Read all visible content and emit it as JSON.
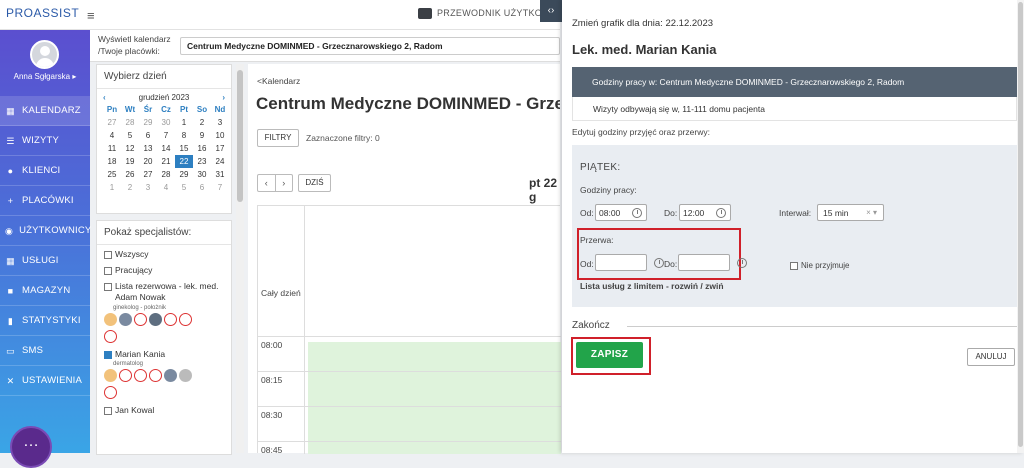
{
  "topbar": {
    "logo_text": "PROASSIST",
    "guide_label": "PRZEWODNIK UŻYTKOW",
    "toggle_icon": "code-icon",
    "menu_icon": "hamburger-icon"
  },
  "sidebar": {
    "username": "Anna Sgłgarska ▸",
    "items": [
      {
        "label": "KALENDARZ",
        "icon": "calendar-icon"
      },
      {
        "label": "WIZYTY",
        "icon": "list-icon"
      },
      {
        "label": "KLIENCI",
        "icon": "users-icon"
      },
      {
        "label": "PLACÓWKI",
        "icon": "building-icon"
      },
      {
        "label": "UŻYTKOWNICY",
        "icon": "user-circle-icon"
      },
      {
        "label": "USŁUGI",
        "icon": "grid-icon"
      },
      {
        "label": "MAGAZYN",
        "icon": "box-icon"
      },
      {
        "label": "STATYSTYKI",
        "icon": "bar-chart-icon"
      },
      {
        "label": "SMS",
        "icon": "message-icon"
      },
      {
        "label": "USTAWIENIA",
        "icon": "wrench-icon"
      }
    ]
  },
  "filterbar": {
    "label": "Wyświetl kalendarz /Twoje placówki:",
    "clinic": "Centrum Medyczne DOMINMED - Grzecznarowskiego 2, Radom"
  },
  "daypicker": {
    "title": "Wybierz dzień",
    "month": "grudzień 2023",
    "prev": "‹",
    "next": "›",
    "weekdays": [
      "Pn",
      "Wt",
      "Śr",
      "Cz",
      "Pt",
      "So",
      "Nd"
    ],
    "days": [
      "27",
      "28",
      "29",
      "30",
      "1",
      "2",
      "3",
      "4",
      "5",
      "6",
      "7",
      "8",
      "9",
      "10",
      "11",
      "12",
      "13",
      "14",
      "15",
      "16",
      "17",
      "18",
      "19",
      "20",
      "21",
      "22",
      "23",
      "24",
      "25",
      "26",
      "27",
      "28",
      "29",
      "30",
      "31",
      "1",
      "2",
      "3",
      "4",
      "5",
      "6",
      "7"
    ],
    "selected_index": 25
  },
  "specialists": {
    "title": "Pokaż specjalistów:",
    "items": [
      {
        "label": "Wszyscy",
        "checked": false,
        "sub": ""
      },
      {
        "label": "Pracujący",
        "checked": false,
        "sub": ""
      },
      {
        "label": "Lista rezerwowa - lek. med. Adam Nowak",
        "checked": false,
        "sub": "ginekolog - położnik"
      },
      {
        "label": "Marian Kania",
        "checked": true,
        "sub": "dermatolog"
      },
      {
        "label": "Jan Kowal",
        "checked": false,
        "sub": ""
      }
    ]
  },
  "main": {
    "breadcrumb": "<Kalendarz",
    "title": "Centrum Medyczne DOMINMED - Grzec",
    "filters_button": "FILTRY",
    "filters_info": "Zaznaczone filtry: 0",
    "prev": "‹",
    "next": "›",
    "today": "DZIŚ",
    "date": "pt 22 g",
    "all_day": "Cały dzień",
    "times": [
      "08:00",
      "08:15",
      "08:30",
      "08:45"
    ]
  },
  "schedule": {
    "date_label": "Zmień grafik dla dnia: 22.12.2023",
    "doctor": "Lek. med. Marian Kania",
    "work_hours_header": "Godziny pracy w: Centrum Medyczne DOMINMED - Grzecznarowskiego 2, Radom",
    "note": "Wizyty odbywają się w, 11-111 domu pacjenta",
    "edit_label": "Edytuj godziny przyjęć oraz przerwy:",
    "day": "PIĄTEK:",
    "work_hours_label": "Godziny pracy:",
    "from_label": "Od:",
    "to_label": "Do:",
    "from_value": "08:00",
    "to_value": "12:00",
    "interval_label": "Interwał:",
    "interval_value": "15 min",
    "break_label": "Przerwa:",
    "break_from": "",
    "break_to": "",
    "no_accept": "Nie przyjmuje",
    "limits_link": "Lista usług z limitem - rozwiń / zwiń",
    "finish_label": "Zakończ",
    "save": "ZAPISZ",
    "cancel": "ANULUJ"
  },
  "colors": {
    "sidebar_top": "#5b4fcf",
    "sidebar_bottom": "#3aa5e6",
    "save_green": "#22a44a",
    "highlight_red": "#d0202a",
    "header_slate": "#556372"
  }
}
